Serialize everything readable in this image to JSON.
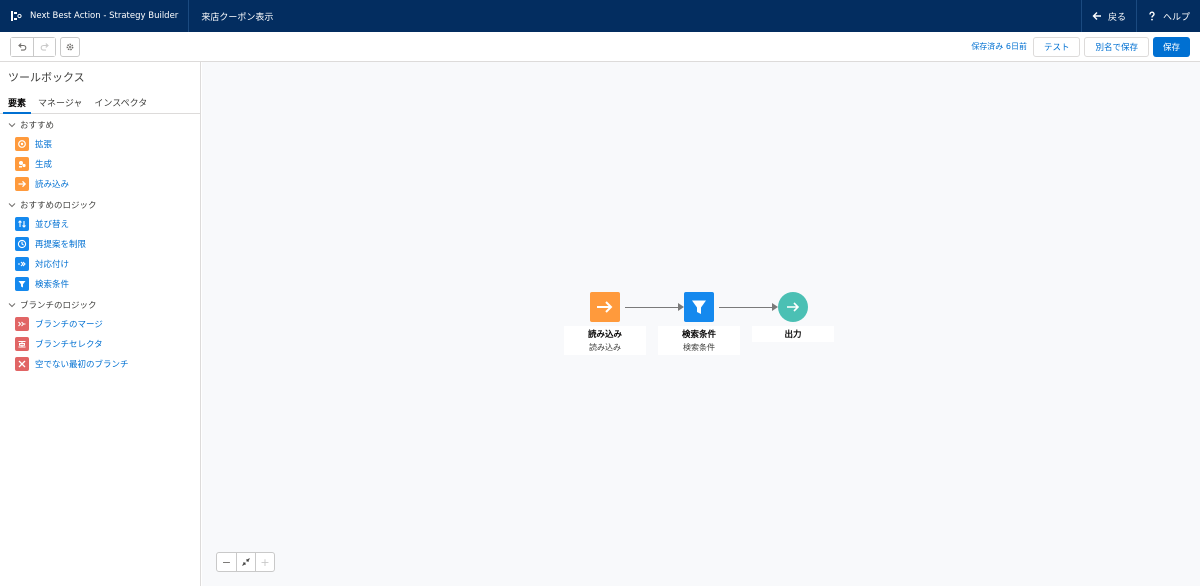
{
  "header": {
    "app_title": "Next Best Action - Strategy Builder",
    "strategy_name": "来店クーポン表示",
    "back_label": "戻る",
    "help_label": "ヘルプ"
  },
  "toolbar": {
    "saved_status": "保存済み 6日前",
    "test_label": "テスト",
    "save_as_label": "別名で保存",
    "save_label": "保存"
  },
  "sidebar": {
    "title": "ツールボックス",
    "tabs": [
      {
        "label": "要素",
        "active": true
      },
      {
        "label": "マネージャ",
        "active": false
      },
      {
        "label": "インスペクタ",
        "active": false
      }
    ],
    "sections": [
      {
        "label": "おすすめ",
        "items": [
          {
            "label": "拡張",
            "icon": "enhance-icon",
            "color": "#ff9a3c"
          },
          {
            "label": "生成",
            "icon": "generate-icon",
            "color": "#ff9a3c"
          },
          {
            "label": "読み込み",
            "icon": "load-arrow-icon",
            "color": "#ff9a3c"
          }
        ]
      },
      {
        "label": "おすすめのロジック",
        "items": [
          {
            "label": "並び替え",
            "icon": "sort-icon",
            "color": "#1589ee"
          },
          {
            "label": "再提案を制限",
            "icon": "clock-icon",
            "color": "#1589ee"
          },
          {
            "label": "対応付け",
            "icon": "map-icon",
            "color": "#1589ee"
          },
          {
            "label": "検索条件",
            "icon": "filter-icon",
            "color": "#1589ee"
          }
        ]
      },
      {
        "label": "ブランチのロジック",
        "items": [
          {
            "label": "ブランチのマージ",
            "icon": "merge-icon",
            "color": "#e16565"
          },
          {
            "label": "ブランチセレクタ",
            "icon": "selector-icon",
            "color": "#e16565"
          },
          {
            "label": "空でない最初のブランチ",
            "icon": "cross-icon",
            "color": "#e16565"
          }
        ]
      }
    ]
  },
  "canvas": {
    "nodes": [
      {
        "title": "読み込み",
        "subtitle": "読み込み",
        "icon": "load-arrow-icon",
        "color": "#ff9a3c"
      },
      {
        "title": "検索条件",
        "subtitle": "検索条件",
        "icon": "filter-icon",
        "color": "#1589ee"
      },
      {
        "title": "出力",
        "subtitle": "",
        "icon": "output-arrow-icon",
        "color": "#4bc0b4"
      }
    ]
  },
  "zoom": {
    "out": "−",
    "in": "+"
  }
}
